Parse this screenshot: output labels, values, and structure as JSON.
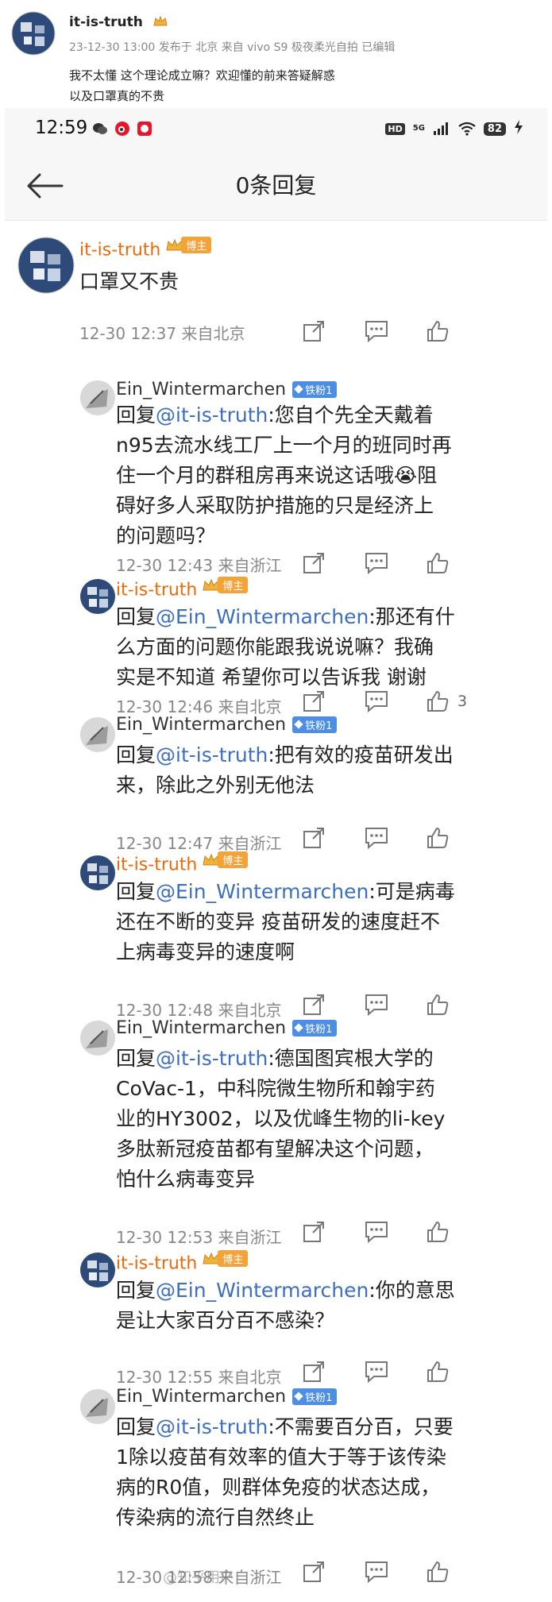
{
  "post": {
    "username": "it-is-truth",
    "meta": "23-12-30 13:00 发布于 北京 来自 vivo S9 极夜柔光自拍 已编辑",
    "body_line1": "我不太懂 这个理论成立嘛？欢迎懂的前来答疑解惑",
    "body_line2": "以及口罩真的不贵"
  },
  "status": {
    "time": "12:59",
    "network": "5G",
    "battery": "82",
    "hd": "HD"
  },
  "nav": {
    "title": "0条回复"
  },
  "main_comment": {
    "name": "it-is-truth",
    "badge": "博主",
    "text": "口罩又不贵",
    "time": "12-30 12:37",
    "location": "来自北京"
  },
  "replies": [
    {
      "name": "Ein_Wintermarchen",
      "badge": "铁粉1",
      "type": "fan",
      "prefix": "回复",
      "mention": "@it-is-truth",
      "lines": [
        ":您自个先全天戴着",
        "n95去流水线工厂上一个月的班同时再",
        "住一个月的群租房再来说这话哦😭阻",
        "碍好多人采取防护措施的只是经济上",
        "的问题吗？"
      ],
      "time": "12-30 12:43",
      "location": "来自浙江"
    },
    {
      "name": "it-is-truth",
      "badge": "博主",
      "type": "blogger",
      "prefix": "回复",
      "mention": "@Ein_Wintermarchen",
      "lines": [
        ":那还有什",
        "么方面的问题你能跟我说说嘛？我确",
        "实是不知道 希望你可以告诉我 谢谢"
      ],
      "time": "12-30 12:46",
      "location": "来自北京",
      "likes": "3"
    },
    {
      "name": "Ein_Wintermarchen",
      "badge": "铁粉1",
      "type": "fan",
      "prefix": "回复",
      "mention": "@it-is-truth",
      "lines": [
        ":把有效的疫苗研发出",
        "来，除此之外别无他法"
      ],
      "time": "12-30 12:47",
      "location": "来自浙江"
    },
    {
      "name": "it-is-truth",
      "badge": "博主",
      "type": "blogger",
      "prefix": "回复",
      "mention": "@Ein_Wintermarchen",
      "lines": [
        ":可是病毒",
        "还在不断的变异 疫苗研发的速度赶不",
        "上病毒变异的速度啊"
      ],
      "time": "12-30 12:48",
      "location": "来自北京"
    },
    {
      "name": "Ein_Wintermarchen",
      "badge": "铁粉1",
      "type": "fan",
      "prefix": "回复",
      "mention": "@it-is-truth",
      "lines": [
        ":德国图宾根大学的",
        "CoVac-1，中科院微生物所和翰宇药",
        "业的HY3002，以及优峰生物的li-key",
        "多肽新冠疫苗都有望解决这个问题，",
        "怕什么病毒变异"
      ],
      "time": "12-30 12:53",
      "location": "来自浙江"
    },
    {
      "name": "it-is-truth",
      "badge": "博主",
      "type": "blogger",
      "prefix": "回复",
      "mention": "@Ein_Wintermarchen",
      "lines": [
        ":你的意思",
        "是让大家百分百不感染？"
      ],
      "time": "12-30 12:55",
      "location": "来自北京"
    },
    {
      "name": "Ein_Wintermarchen",
      "badge": "铁粉1",
      "type": "fan",
      "prefix": "回复",
      "mention": "@it-is-truth",
      "lines": [
        ":不需要百分百，只要",
        "1除以疫苗有效率的值大于等于该传染",
        "病的R0值，则群体免疫的状态达成，",
        "传染病的流行自然终止"
      ],
      "time": "12-30 12:58",
      "location": "来自浙江"
    }
  ],
  "watermark": "@知乎用户",
  "colors": {
    "blogger": "#e86a0a",
    "mention": "#3c6fbf",
    "fan_badge": "#4c8ee6",
    "blogger_tag": "#f2a33a"
  }
}
